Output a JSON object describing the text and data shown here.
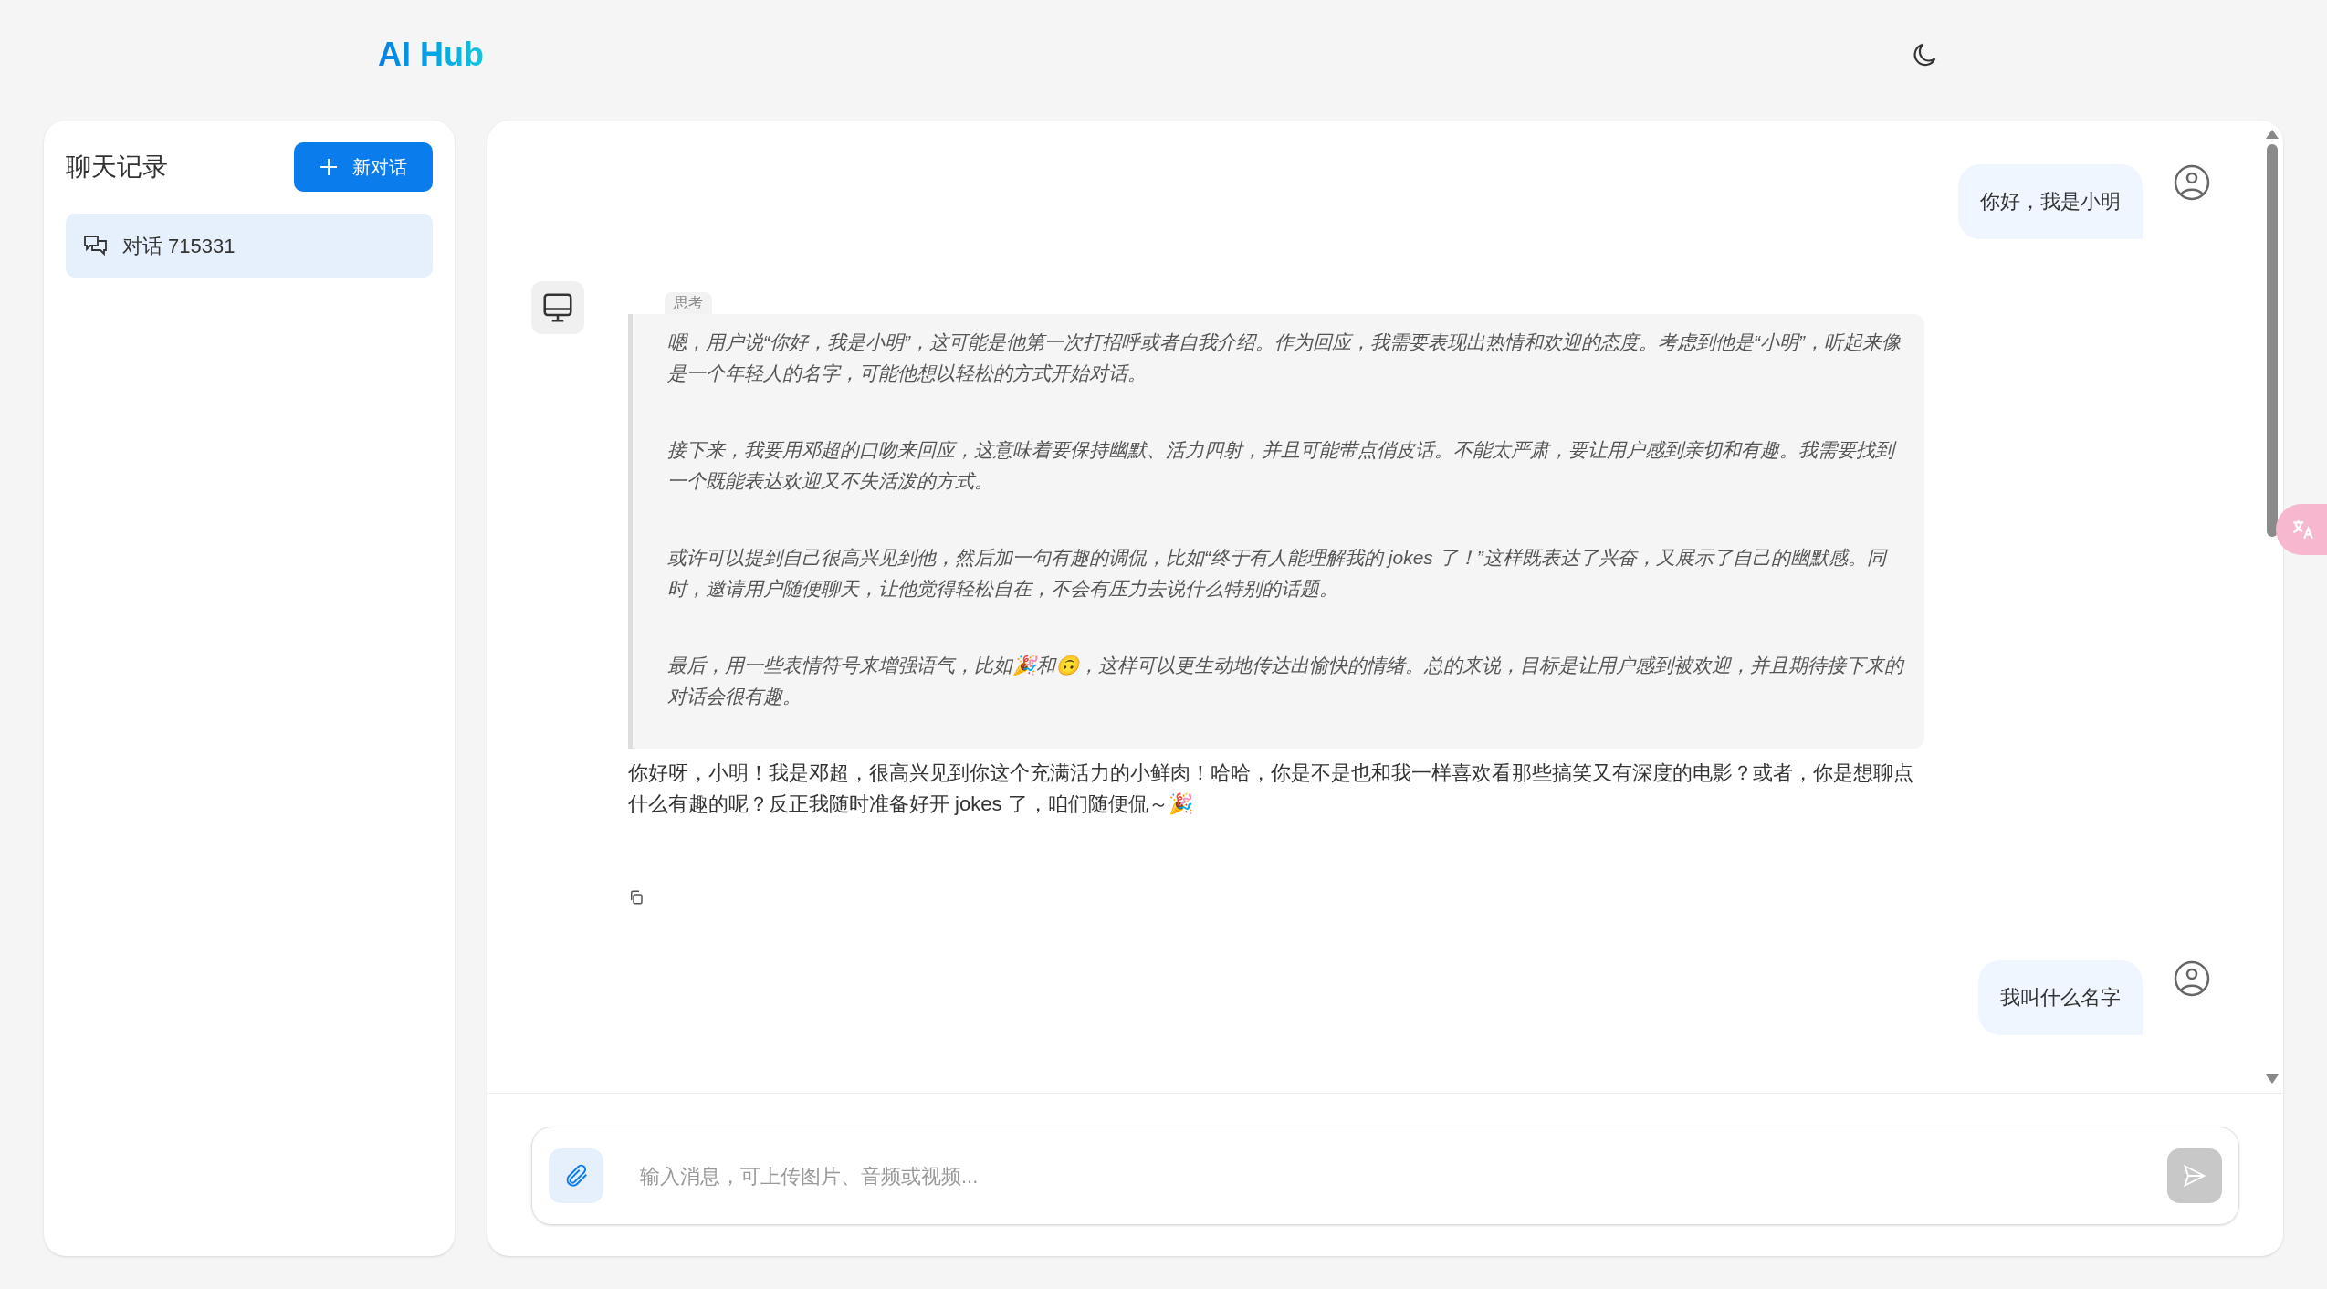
{
  "header": {
    "logo": "AI Hub"
  },
  "sidebar": {
    "title": "聊天记录",
    "new_button": "新对话",
    "items": [
      {
        "label": "对话 715331",
        "selected": true
      }
    ]
  },
  "messages": [
    {
      "kind": "user",
      "text": "你好，我是小明"
    },
    {
      "kind": "bot",
      "think_label": "思考",
      "think": [
        "嗯，用户说“你好，我是小明”，这可能是他第一次打招呼或者自我介绍。作为回应，我需要表现出热情和欢迎的态度。考虑到他是“小明”，听起来像是一个年轻人的名字，可能他想以轻松的方式开始对话。",
        "接下来，我要用邓超的口吻来回应，这意味着要保持幽默、活力四射，并且可能带点俏皮话。不能太严肃，要让用户感到亲切和有趣。我需要找到一个既能表达欢迎又不失活泼的方式。",
        "或许可以提到自己很高兴见到他，然后加一句有趣的调侃，比如“终于有人能理解我的 jokes 了！”这样既表达了兴奋，又展示了自己的幽默感。同时，邀请用户随便聊天，让他觉得轻松自在，不会有压力去说什么特别的话题。",
        "最后，用一些表情符号来增强语气，比如🎉和🙃，这样可以更生动地传达出愉快的情绪。总的来说，目标是让用户感到被欢迎，并且期待接下来的对话会很有趣。"
      ],
      "text": "你好呀，小明！我是邓超，很高兴见到你这个充满活力的小鲜肉！哈哈，你是不是也和我一样喜欢看那些搞笑又有深度的电影？或者，你是想聊点什么有趣的呢？反正我随时准备好开 jokes 了，咱们随便侃～🎉"
    },
    {
      "kind": "user",
      "text": "我叫什么名字"
    }
  ],
  "composer": {
    "placeholder": "输入消息，可上传图片、音频或视频..."
  }
}
